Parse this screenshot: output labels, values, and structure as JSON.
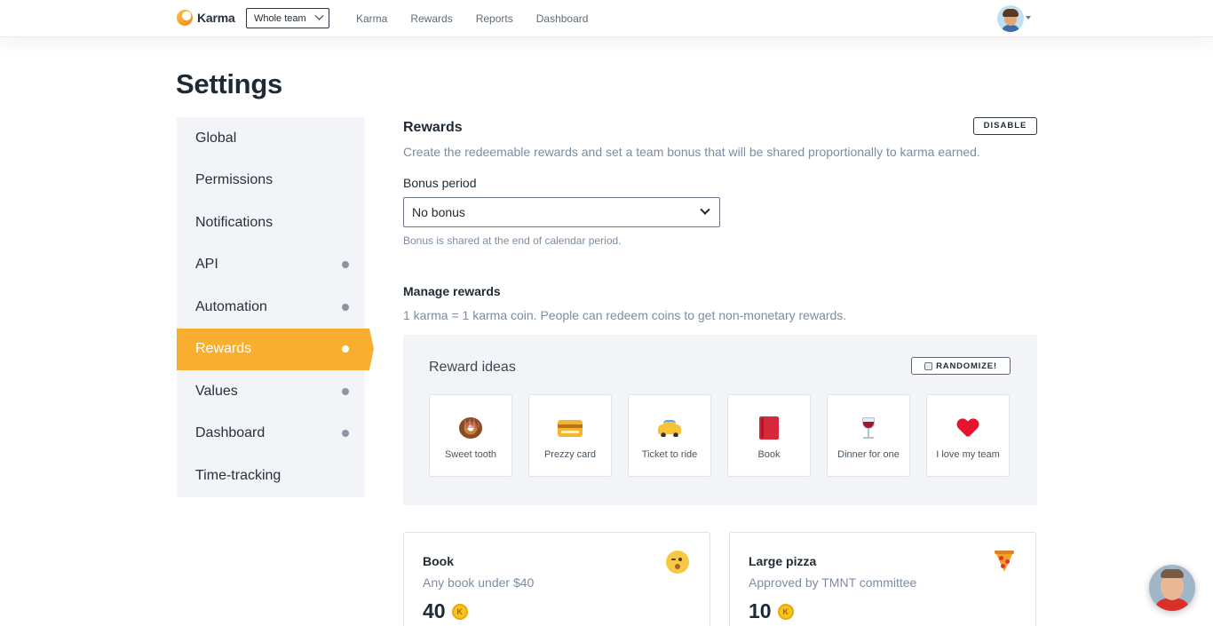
{
  "brand": {
    "name": "Karma"
  },
  "team_select": {
    "value": "Whole team"
  },
  "nav": {
    "links": [
      "Karma",
      "Rewards",
      "Reports",
      "Dashboard"
    ]
  },
  "page": {
    "title": "Settings"
  },
  "sidebar": {
    "items": [
      {
        "label": "Global",
        "dot": false
      },
      {
        "label": "Permissions",
        "dot": false
      },
      {
        "label": "Notifications",
        "dot": false
      },
      {
        "label": "API",
        "dot": true
      },
      {
        "label": "Automation",
        "dot": true
      },
      {
        "label": "Rewards",
        "dot": true,
        "active": true
      },
      {
        "label": "Values",
        "dot": true
      },
      {
        "label": "Dashboard",
        "dot": true
      },
      {
        "label": "Time-tracking",
        "dot": false
      }
    ]
  },
  "rewards": {
    "title": "Rewards",
    "disable_label": "DISABLE",
    "description": "Create the redeemable rewards and set a team bonus that will be shared proportionally to karma earned.",
    "bonus_label": "Bonus period",
    "bonus_value": "No bonus",
    "bonus_hint": "Bonus is shared at the end of calendar period.",
    "manage_title": "Manage rewards",
    "manage_desc": "1 karma = 1 karma coin. People can redeem coins to get non-monetary rewards."
  },
  "ideas": {
    "title": "Reward ideas",
    "randomize_label": "RANDOMIZE!",
    "items": [
      {
        "label": "Sweet tooth",
        "icon": "donut-icon"
      },
      {
        "label": "Prezzy card",
        "icon": "credit-card-icon"
      },
      {
        "label": "Ticket to ride",
        "icon": "taxi-icon"
      },
      {
        "label": "Book",
        "icon": "book-icon"
      },
      {
        "label": "Dinner for one",
        "icon": "wine-glass-icon"
      },
      {
        "label": "I love my team",
        "icon": "heart-icon"
      }
    ]
  },
  "reward_cards": [
    {
      "title": "Book",
      "description": "Any book under $40",
      "price": "40",
      "icon": "winking-face-icon"
    },
    {
      "title": "Large pizza",
      "description": "Approved by TMNT committee",
      "price": "10",
      "icon": "pizza-icon"
    }
  ],
  "coin_symbol": "K",
  "colors": {
    "accent": "#f8ae2f",
    "sidebar_bg": "#f2f4f7",
    "muted_text": "#7b8da4"
  }
}
